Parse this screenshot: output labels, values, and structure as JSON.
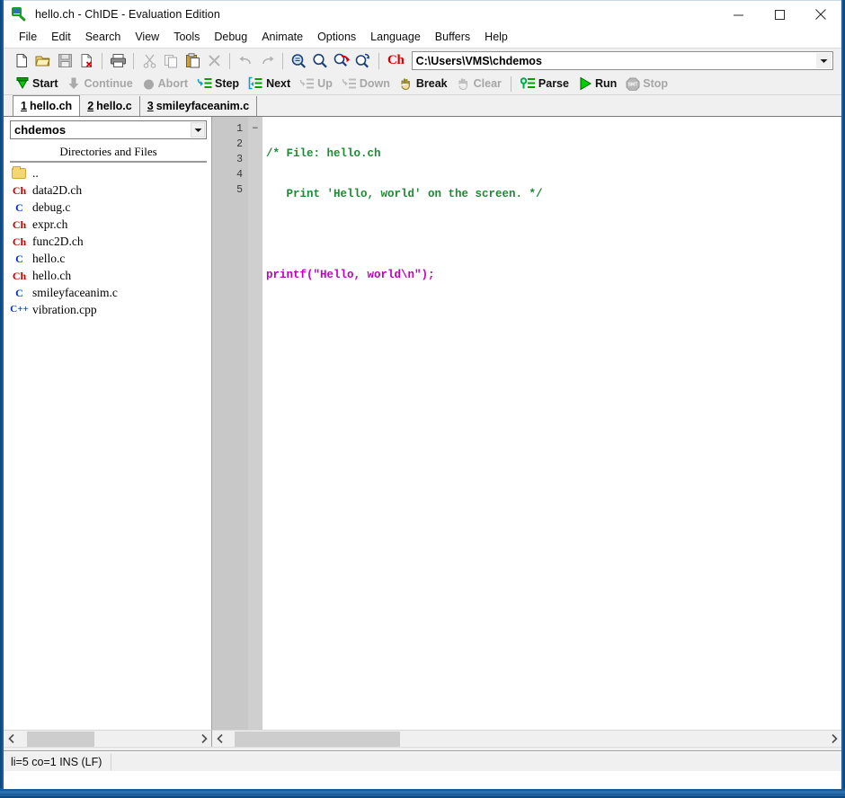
{
  "window": {
    "title": "hello.ch - ChIDE - Evaluation Edition",
    "app_icon": "chide-magnifier-icon",
    "minimize_label": "—",
    "maximize_label": "☐",
    "close_label": "✕"
  },
  "menubar": {
    "items": [
      {
        "label": "File"
      },
      {
        "label": "Edit"
      },
      {
        "label": "Search"
      },
      {
        "label": "View"
      },
      {
        "label": "Tools"
      },
      {
        "label": "Debug"
      },
      {
        "label": "Animate"
      },
      {
        "label": "Options"
      },
      {
        "label": "Language"
      },
      {
        "label": "Buffers"
      },
      {
        "label": "Help"
      }
    ]
  },
  "toolbar": {
    "buttons": [
      {
        "name": "new-file",
        "icon": "new-document-icon",
        "enabled": true
      },
      {
        "name": "open-file",
        "icon": "open-folder-icon",
        "enabled": true
      },
      {
        "name": "save-file",
        "icon": "save-disk-icon",
        "enabled": false
      },
      {
        "name": "close-file",
        "icon": "close-document-icon",
        "enabled": true
      },
      {
        "name": "print",
        "icon": "printer-icon",
        "enabled": true
      },
      {
        "name": "cut",
        "icon": "scissors-icon",
        "enabled": false
      },
      {
        "name": "copy",
        "icon": "copy-icon",
        "enabled": false
      },
      {
        "name": "paste",
        "icon": "paste-icon",
        "enabled": true
      },
      {
        "name": "delete",
        "icon": "x-delete-icon",
        "enabled": false
      },
      {
        "name": "undo",
        "icon": "undo-arrow-icon",
        "enabled": false
      },
      {
        "name": "redo",
        "icon": "redo-arrow-icon",
        "enabled": false
      },
      {
        "name": "find",
        "icon": "find-icon",
        "enabled": true
      },
      {
        "name": "find-next",
        "icon": "magnifier-icon",
        "enabled": true
      },
      {
        "name": "replace",
        "icon": "find-replace-icon",
        "enabled": true
      },
      {
        "name": "find-in-files",
        "icon": "find-refresh-icon",
        "enabled": true
      }
    ],
    "ch_logo": "Ch",
    "path_value": "C:\\Users\\VMS\\chdemos",
    "path_dropdown_icon": "chevron-down-icon"
  },
  "debugbar": {
    "buttons": [
      {
        "name": "start",
        "label": "Start",
        "icon": "green-down-arrow-icon",
        "enabled": true
      },
      {
        "name": "continue",
        "label": "Continue",
        "icon": "gray-down-arrow-icon",
        "enabled": false
      },
      {
        "name": "abort",
        "label": "Abort",
        "icon": "gray-circle-icon",
        "enabled": false
      },
      {
        "name": "step",
        "label": "Step",
        "icon": "step-into-icon",
        "enabled": true
      },
      {
        "name": "next",
        "label": "Next",
        "icon": "step-over-icon",
        "enabled": true
      },
      {
        "name": "up",
        "label": "Up",
        "icon": "step-up-icon",
        "enabled": false
      },
      {
        "name": "down",
        "label": "Down",
        "icon": "step-down-icon",
        "enabled": false
      },
      {
        "name": "break",
        "label": "Break",
        "icon": "hand-break-icon",
        "enabled": true
      },
      {
        "name": "clear",
        "label": "Clear",
        "icon": "clear-break-icon",
        "enabled": false
      },
      {
        "name": "parse",
        "label": "Parse",
        "icon": "green-key-icon",
        "enabled": true
      },
      {
        "name": "run",
        "label": "Run",
        "icon": "green-play-icon",
        "enabled": true
      },
      {
        "name": "stop",
        "label": "Stop",
        "icon": "gray-stop-icon",
        "enabled": false
      }
    ]
  },
  "tabs": [
    {
      "num": "1",
      "label": "hello.ch",
      "active": true
    },
    {
      "num": "2",
      "label": "hello.c",
      "active": false
    },
    {
      "num": "3",
      "label": "smileyfaceanim.c",
      "active": false
    }
  ],
  "sidebar": {
    "directory_value": "chdemos",
    "directory_dropdown_icon": "chevron-down-icon",
    "header": "Directories and Files",
    "files": [
      {
        "icon": "folder-icon",
        "kind": "folder",
        "name": ".."
      },
      {
        "icon": "ch-file-icon",
        "kind": "ch",
        "name": "data2D.ch"
      },
      {
        "icon": "c-file-icon",
        "kind": "c",
        "name": "debug.c"
      },
      {
        "icon": "ch-file-icon",
        "kind": "ch",
        "name": "expr.ch"
      },
      {
        "icon": "ch-file-icon",
        "kind": "ch",
        "name": "func2D.ch"
      },
      {
        "icon": "c-file-icon",
        "kind": "c",
        "name": "hello.c"
      },
      {
        "icon": "ch-file-icon",
        "kind": "ch",
        "name": "hello.ch"
      },
      {
        "icon": "c-file-icon",
        "kind": "c",
        "name": "smileyfaceanim.c"
      },
      {
        "icon": "cpp-file-icon",
        "kind": "cpp",
        "name": "vibration.cpp"
      }
    ]
  },
  "editor": {
    "line_numbers": [
      "1",
      "2",
      "3",
      "4",
      "5"
    ],
    "fold_markers": [
      "−",
      "",
      "",
      "",
      ""
    ],
    "lines": [
      {
        "n": 1,
        "segments": [
          {
            "text": "/* File: hello.ch",
            "type": "comment"
          }
        ]
      },
      {
        "n": 2,
        "segments": [
          {
            "text": "   Print 'Hello, world' on the screen. */",
            "type": "comment"
          }
        ]
      },
      {
        "n": 3,
        "segments": [
          {
            "text": "",
            "type": "plain"
          }
        ]
      },
      {
        "n": 4,
        "segments": [
          {
            "text": "printf",
            "type": "keyword"
          },
          {
            "text": "(\"Hello, world\\n\");",
            "type": "string"
          }
        ]
      },
      {
        "n": 5,
        "segments": [
          {
            "text": "",
            "type": "plain"
          }
        ]
      }
    ],
    "raw_text": "/* File: hello.ch\n   Print 'Hello, world' on the screen. */\n\nprintf(\"Hello, world\\n\");\n"
  },
  "scrollbars": {
    "left_arrow_icon": "chevron-left-icon",
    "right_arrow_icon": "chevron-right-icon"
  },
  "statusbar": {
    "text": "li=5 co=1 INS (LF)"
  },
  "colors": {
    "comment_green": "#1d8a33",
    "keyword_magenta": "#c000c0",
    "ch_red": "#cc0000",
    "c_blue": "#0033cc",
    "accent_blue": "#1b5a96",
    "toolbar_bg": "#f0f0f0",
    "gutter_bg": "#c8c8c8"
  }
}
